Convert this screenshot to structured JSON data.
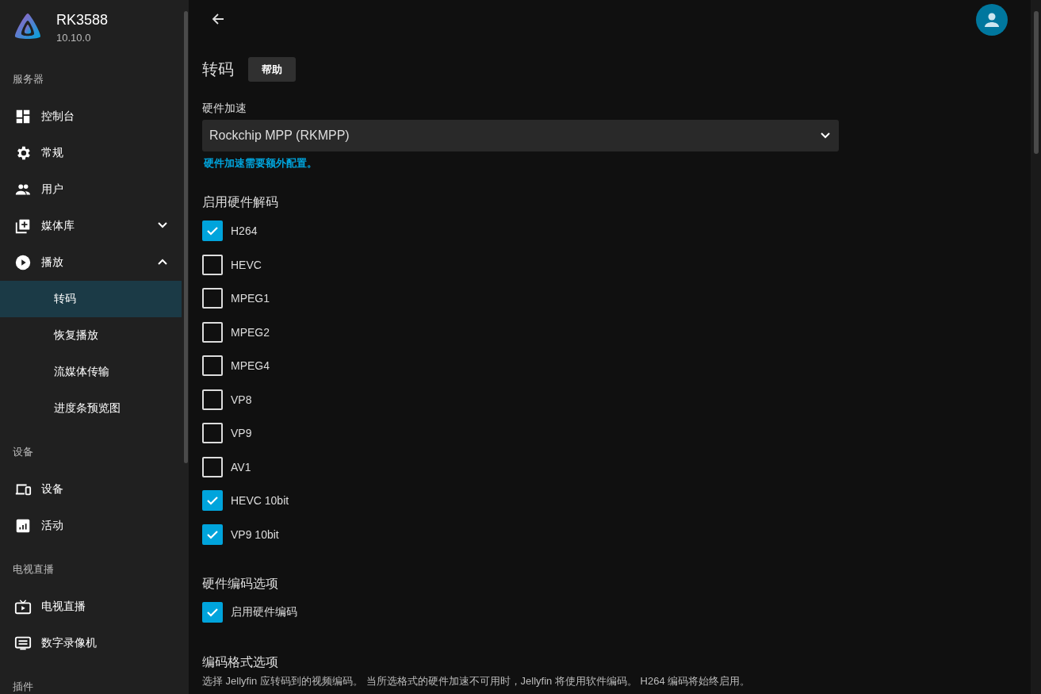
{
  "sidebar": {
    "server_name": "RK3588",
    "version": "10.10.0",
    "sections": [
      {
        "title": "服务器",
        "items": [
          {
            "label": "控制台"
          },
          {
            "label": "常规"
          },
          {
            "label": "用户"
          },
          {
            "label": "媒体库",
            "expanded": false
          },
          {
            "label": "播放",
            "expanded": true,
            "children": [
              {
                "label": "转码",
                "selected": true
              },
              {
                "label": "恢复播放",
                "selected": false
              },
              {
                "label": "流媒体传输",
                "selected": false
              },
              {
                "label": "进度条预览图",
                "selected": false
              }
            ]
          }
        ]
      },
      {
        "title": "设备",
        "items": [
          {
            "label": "设备"
          },
          {
            "label": "活动"
          }
        ]
      },
      {
        "title": "电视直播",
        "items": [
          {
            "label": "电视直播"
          },
          {
            "label": "数字录像机"
          }
        ]
      },
      {
        "title": "插件"
      }
    ]
  },
  "page": {
    "title": "转码",
    "help_button": "帮助",
    "hw_accel": {
      "label": "硬件加速",
      "value": "Rockchip MPP (RKMPP)",
      "link": "硬件加速需要额外配置。"
    },
    "decoding": {
      "title": "启用硬件解码",
      "options": [
        {
          "label": "H264",
          "checked": true
        },
        {
          "label": "HEVC",
          "checked": false
        },
        {
          "label": "MPEG1",
          "checked": false
        },
        {
          "label": "MPEG2",
          "checked": false
        },
        {
          "label": "MPEG4",
          "checked": false
        },
        {
          "label": "VP8",
          "checked": false
        },
        {
          "label": "VP9",
          "checked": false
        },
        {
          "label": "AV1",
          "checked": false
        },
        {
          "label": "HEVC 10bit",
          "checked": true
        },
        {
          "label": "VP9 10bit",
          "checked": true
        }
      ]
    },
    "encoding": {
      "title": "硬件编码选项",
      "options": [
        {
          "label": "启用硬件编码",
          "checked": true
        }
      ]
    },
    "format": {
      "title": "编码格式选项",
      "description": "选择 Jellyfin 应转码到的视频编码。 当所选格式的硬件加速不可用时，Jellyfin 将使用软件编码。 H264 编码将始终启用。"
    }
  }
}
